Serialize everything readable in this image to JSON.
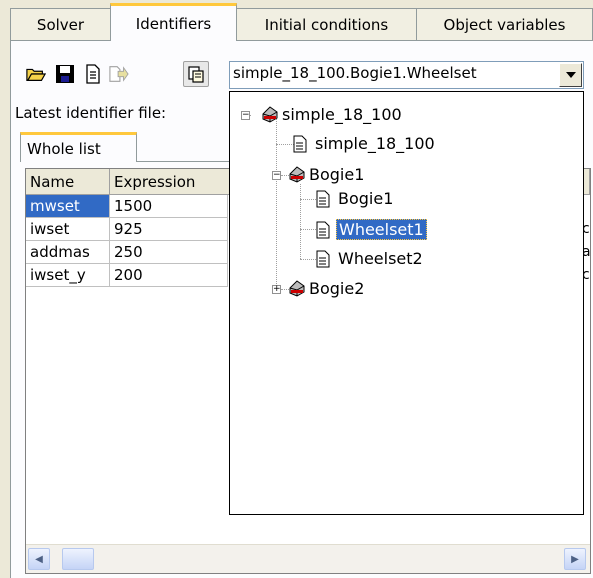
{
  "tabs": [
    "Solver",
    "Identifiers",
    "Initial conditions",
    "Object variables"
  ],
  "active_tab": "Identifiers",
  "toolbar": {
    "icons": [
      "open-folder-icon",
      "save-icon",
      "document-icon",
      "forward-document-icon",
      "paste-icon"
    ],
    "combo_value": "simple_18_100.Bogie1.Wheelset"
  },
  "latest_label": "Latest identifier file:",
  "inner_tab": "Whole list",
  "grid": {
    "headers": [
      "Name",
      "Expression"
    ],
    "rows": [
      {
        "name": "mwset",
        "expr": "1500",
        "selected": true
      },
      {
        "name": "iwset",
        "expr": "925",
        "selected": false
      },
      {
        "name": "addmas",
        "expr": "250",
        "selected": false
      },
      {
        "name": "iwset_y",
        "expr": "200",
        "selected": false
      }
    ],
    "partial_right": [
      "",
      "",
      "c",
      "a",
      "c"
    ]
  },
  "tree": [
    {
      "label": "simple_18_100",
      "type": "model",
      "expander": "−"
    },
    {
      "label": "simple_18_100",
      "type": "doc"
    },
    {
      "label": "Bogie1",
      "type": "model",
      "expander": "−"
    },
    {
      "label": "Bogie1",
      "type": "doc"
    },
    {
      "label": "Wheelset1",
      "type": "doc",
      "selected": true
    },
    {
      "label": "Wheelset2",
      "type": "doc"
    },
    {
      "label": "Bogie2",
      "type": "model",
      "expander": "+"
    }
  ],
  "colors": {
    "selection": "#316ac5",
    "tab_highlight": "#ffc83c",
    "background": "#ece9d8"
  }
}
